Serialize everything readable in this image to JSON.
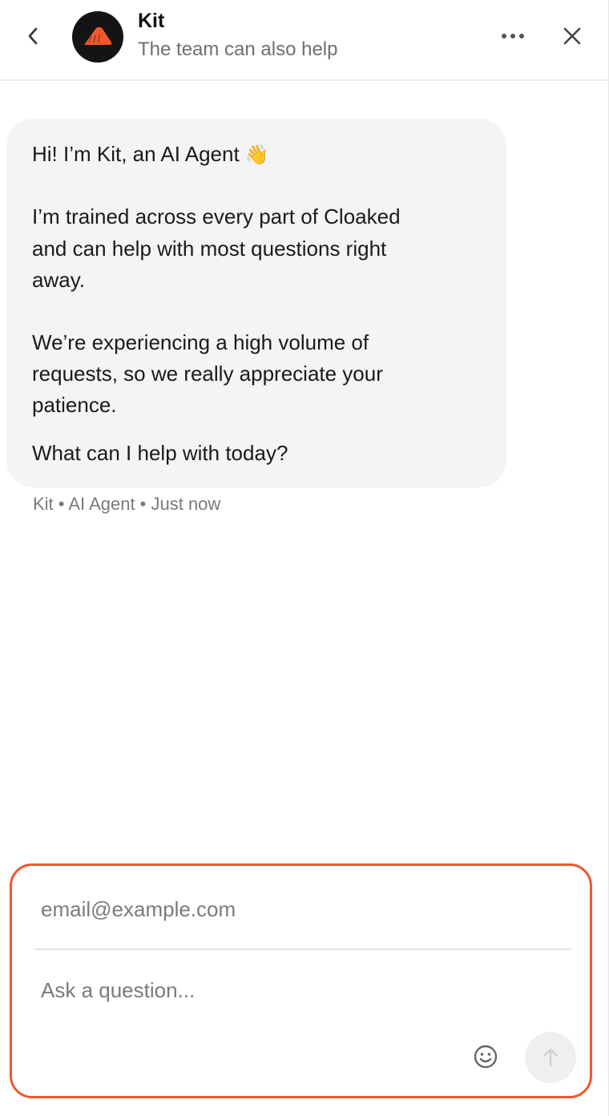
{
  "header": {
    "back_icon": "chevron-left-icon",
    "avatar_icon": "cloaked-logo-icon",
    "title": "Kit",
    "subtitle": "The team can also help",
    "more_icon": "more-horizontal-icon",
    "close_icon": "close-icon"
  },
  "message": {
    "line1": "Hi! I’m Kit, an AI Agent",
    "wave": "👋",
    "line2": "I’m trained across every part of Cloaked",
    "line3": "and can help with most questions right",
    "line4": "away.",
    "line5": "We’re experiencing a high volume of",
    "line6": "requests, so we really appreciate your",
    "line7": "patience.",
    "line8": "What can I help with today?",
    "meta": "Kit • AI Agent • Just now"
  },
  "composer": {
    "email_placeholder": "email@example.com",
    "question_placeholder": "Ask a question...",
    "emoji_icon": "smiley-icon",
    "send_icon": "arrow-up-icon"
  },
  "colors": {
    "accent": "#f0582a",
    "bubble": "#f4f4f4",
    "avatar_bg": "#141414"
  }
}
